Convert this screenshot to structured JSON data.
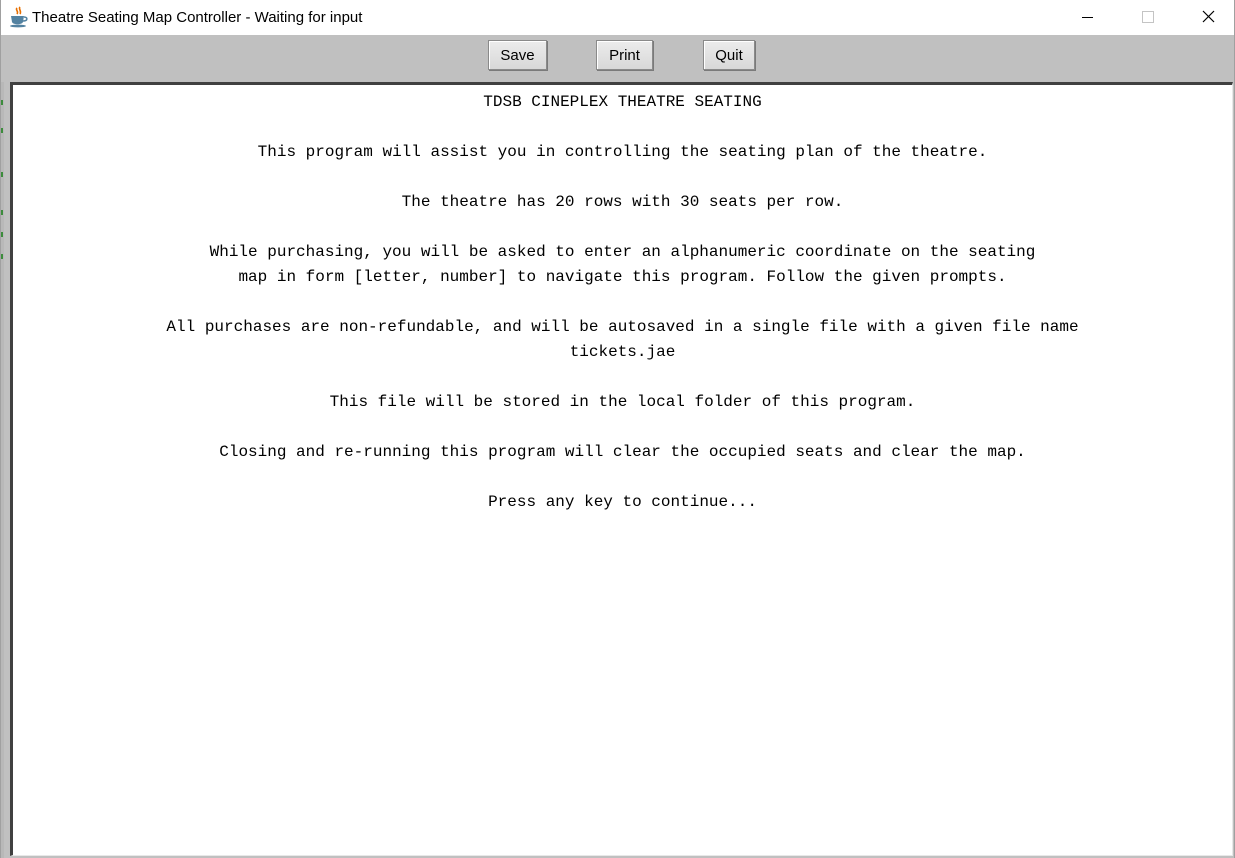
{
  "window": {
    "title": "Theatre Seating Map Controller - Waiting for input",
    "app_icon": "java-coffee-cup-icon",
    "controls": {
      "minimize_icon": "minimize-icon",
      "maximize_icon": "maximize-icon",
      "close_icon": "close-icon"
    }
  },
  "toolbar": {
    "save_label": "Save",
    "print_label": "Print",
    "quit_label": "Quit"
  },
  "console": {
    "lines": [
      "TDSB CINEPLEX THEATRE SEATING",
      "This program will assist you in controlling the seating plan of the theatre.",
      "The theatre has 20 rows with 30 seats per row.",
      "While purchasing, you will be asked to enter an alphanumeric coordinate on the seating",
      "map in form [letter, number] to navigate this program. Follow the given prompts.",
      "All purchases are non-refundable, and will be autosaved in a single file with a given file name",
      "tickets.jae",
      "This file will be stored in the local folder of this program.",
      "Closing and re-running this program will clear the occupied seats and clear the map.",
      "Press any key to continue..."
    ]
  },
  "colors": {
    "window_background": "#c0c0c0",
    "console_background": "#ffffff",
    "text": "#000000"
  }
}
